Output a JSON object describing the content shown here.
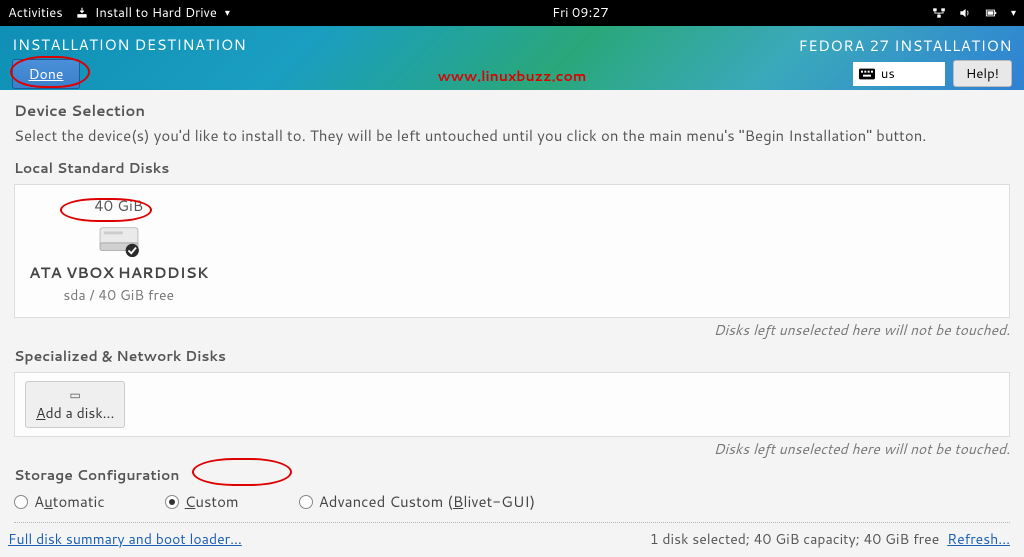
{
  "topbar": {
    "activities": "Activities",
    "app": "Install to Hard Drive",
    "clock": "Fri 09:27"
  },
  "header": {
    "title": "INSTALLATION DESTINATION",
    "done": "Done",
    "brand": "FEDORA 27 INSTALLATION",
    "kbd": "us",
    "help": "Help!"
  },
  "device_selection": {
    "title": "Device Selection",
    "desc": "Select the device(s) you'd like to install to.  They will be left untouched until you click on the main menu's \"Begin Installation\" button."
  },
  "local_disks": {
    "label": "Local Standard Disks",
    "disk": {
      "size": "40 GiB",
      "name": "ATA VBOX HARDDISK",
      "sub": "sda   /   40 GiB free"
    },
    "hint": "Disks left unselected here will not be touched."
  },
  "net_disks": {
    "label": "Specialized & Network Disks",
    "add": "Add a disk...",
    "hint": "Disks left unselected here will not be touched."
  },
  "storage": {
    "label": "Storage Configuration",
    "opt_auto": "Automatic",
    "opt_custom": "Custom",
    "opt_adv": "Advanced Custom (Blivet-GUI)"
  },
  "footer": {
    "summary": "Full disk summary and boot loader...",
    "status": "1 disk selected; 40 GiB capacity; 40 GiB free",
    "refresh": "Refresh..."
  },
  "watermark": "www.linuxbuzz.com"
}
